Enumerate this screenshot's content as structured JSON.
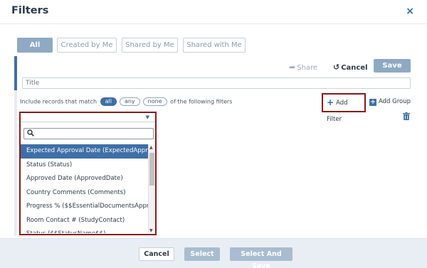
{
  "dialog": {
    "title": "Filters",
    "close_glyph": "×"
  },
  "tabs": [
    {
      "label": "All",
      "active": true
    },
    {
      "label": "Created by Me",
      "active": false
    },
    {
      "label": "Shared by Me",
      "active": false
    },
    {
      "label": "Shared with Me",
      "active": false
    }
  ],
  "toolbar": {
    "share_label": "Share",
    "cancel_label": "Cancel",
    "save_label": "Save"
  },
  "filter": {
    "title_value": "Title",
    "match_prefix": "Include records that match",
    "match_options": [
      "all",
      "any",
      "none"
    ],
    "match_selected": "all",
    "match_suffix": "of the following filters",
    "add_filter_label": "Add Filter",
    "add_group_label": "Add Group"
  },
  "dropdown": {
    "search_value": "",
    "options": [
      "Expected Approval Date (ExpectedApproval",
      "Status (Status)",
      "Approved Date (ApprovedDate)",
      "Country Comments (Comments)",
      "Progress % ($$EssentialDocumentsApprov",
      "Room Contact # (StudyContact)",
      "Status ($$StatusName$$)"
    ],
    "selected_index": 0
  },
  "footer": {
    "cancel_label": "Cancel",
    "select_label": "Select",
    "select_save_label": "Select And Save"
  },
  "colors": {
    "accent": "#3e6fa6",
    "muted_button": "#8ea9c4",
    "highlight_border": "#8b1a1a",
    "footer_bg": "#e9eef4"
  }
}
